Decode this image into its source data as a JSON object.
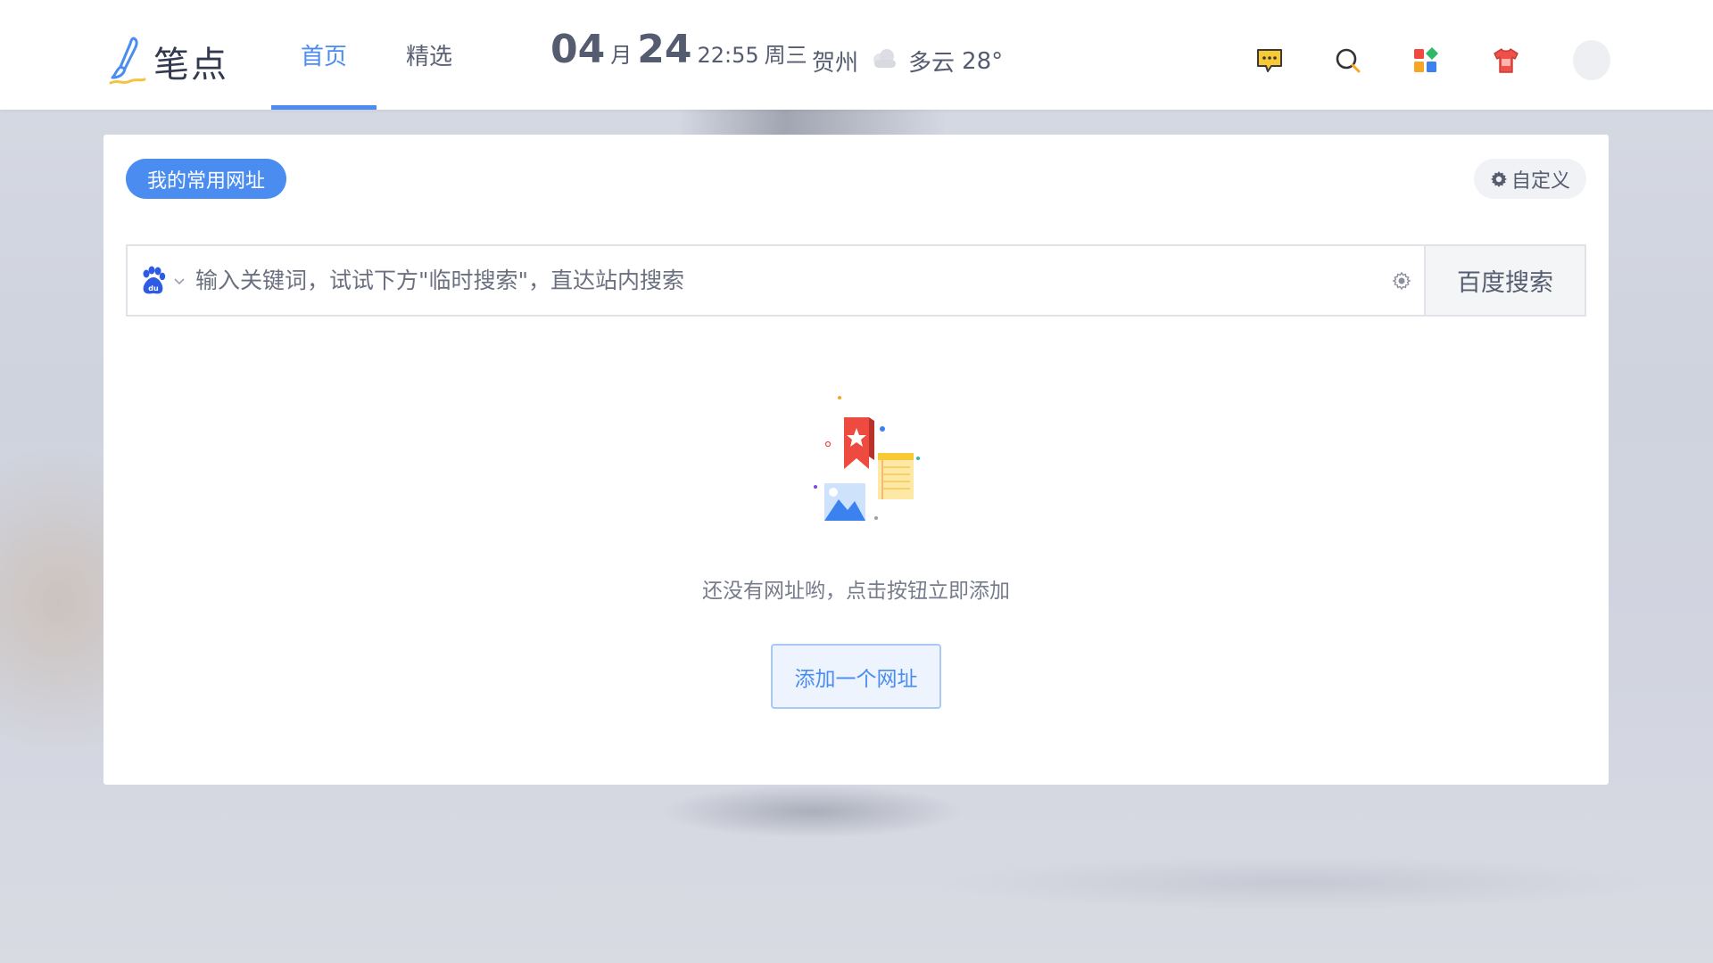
{
  "header": {
    "logo_text": "笔点",
    "tabs": [
      {
        "label": "首页",
        "active": true
      },
      {
        "label": "精选",
        "active": false
      }
    ],
    "date": {
      "month": "04",
      "month_unit": "月",
      "day": "24",
      "time": "22:55",
      "weekday": "周三"
    },
    "weather": {
      "city": "贺州",
      "icon": "cloud-icon",
      "condition": "多云",
      "temperature": "28°"
    },
    "icons": [
      "message-icon",
      "search-icon",
      "apps-icon",
      "skin-icon"
    ],
    "accent_color": "#4a8cf0"
  },
  "card": {
    "section_title": "我的常用网址",
    "customize_label": "自定义",
    "search": {
      "engine_icon": "baidu-paw-icon",
      "placeholder": "输入关键词，试试下方\"临时搜索\"，直达站内搜索",
      "value": "",
      "button_label": "百度搜索"
    },
    "empty_state": {
      "illustration": "bookmark-empty-illustration",
      "message": "还没有网址哟，点击按钮立即添加",
      "button_label": "添加一个网址"
    }
  }
}
